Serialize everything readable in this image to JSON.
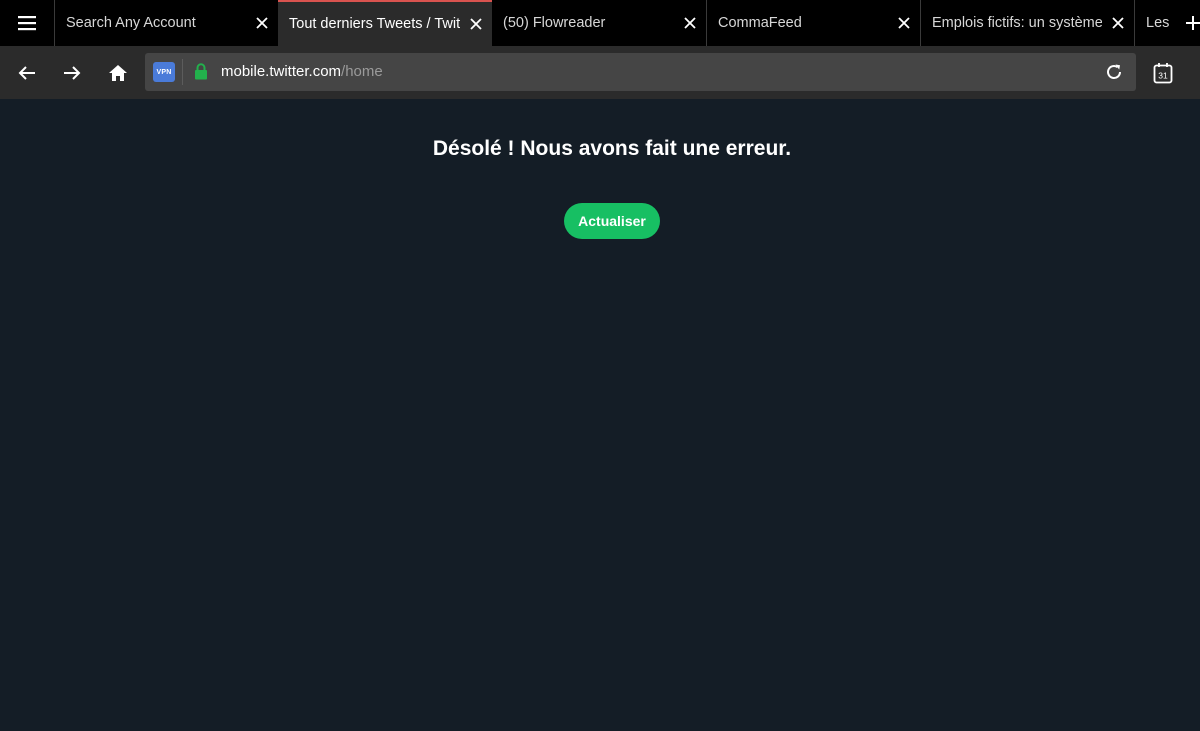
{
  "tabs": [
    {
      "label": "Search Any Account",
      "width": 216
    },
    {
      "label": "Tout derniers Tweets / Twitter",
      "width": 214
    },
    {
      "label": "(50) Flowreader",
      "width": 214
    },
    {
      "label": "CommaFeed",
      "width": 214
    },
    {
      "label": "Emplois fictifs: un système",
      "width": 214
    },
    {
      "label": "Les",
      "width": 60
    }
  ],
  "active_tab": 1,
  "address_bar": {
    "vpn_badge": "VPN",
    "host": "mobile.twitter.com",
    "path": "/home"
  },
  "tab_switcher_count": "31",
  "page": {
    "error_message": "Désolé ! Nous avons fait une erreur.",
    "refresh_label": "Actualiser"
  },
  "colors": {
    "page_background": "#141d26",
    "button_green": "#17bf63",
    "toolbar": "#2b2b2b",
    "tabstrip": "#000000",
    "active_tab_accent": "#d9534f",
    "secure_lock": "#22b14c"
  }
}
